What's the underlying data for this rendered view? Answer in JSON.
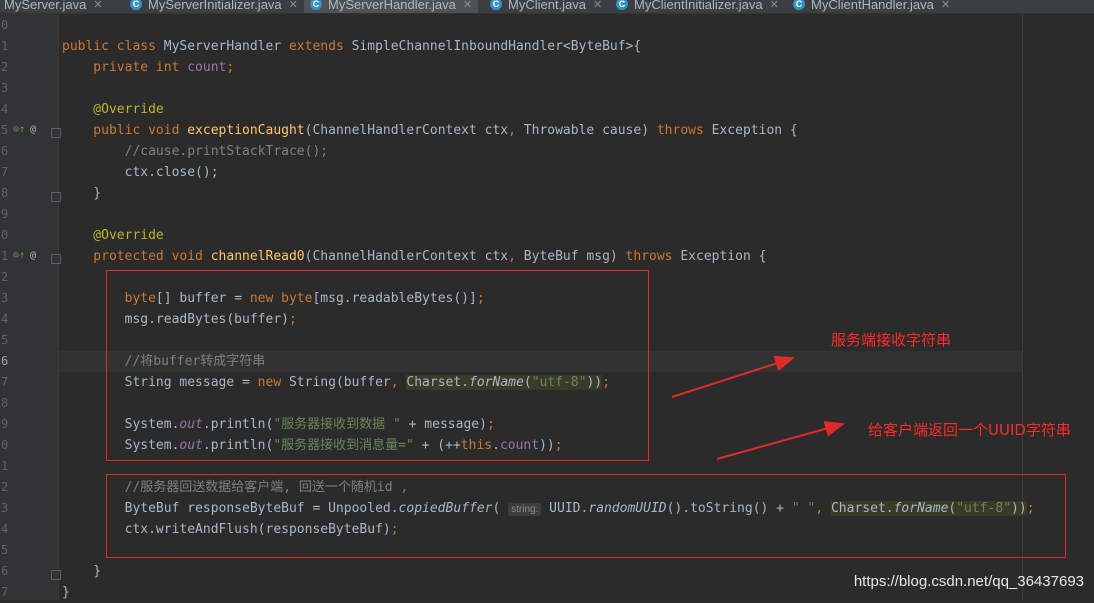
{
  "tabs": [
    {
      "label": "MyServer.java",
      "active": false
    },
    {
      "label": "MyServerInitializer.java",
      "active": false
    },
    {
      "label": "MyServerHandler.java",
      "active": true
    },
    {
      "label": "MyClient.java",
      "active": false
    },
    {
      "label": "MyClientInitializer.java",
      "active": false
    },
    {
      "label": "MyClientHandler.java",
      "active": false
    }
  ],
  "gutter": {
    "line_numbers": [
      "0",
      "1",
      "2",
      "3",
      "4",
      "5",
      "6",
      "7",
      "8",
      "9",
      "0",
      "1",
      "2",
      "3",
      "4",
      "5",
      "6",
      "7",
      "8",
      "9",
      "0",
      "1",
      "2",
      "3",
      "4",
      "5",
      "6",
      "7",
      "8"
    ]
  },
  "code": {
    "l1_a": "public class ",
    "l1_b": "MyServerHandler ",
    "l1_c": "extends ",
    "l1_d": "SimpleChannelInboundHandler<ByteBuf>{",
    "l2_a": "    private int ",
    "l2_b": "count",
    "l2_c": ";",
    "l4": "    @Override",
    "l5_a": "    public void ",
    "l5_b": "exceptionCaught",
    "l5_c": "(ChannelHandlerContext ctx",
    "l5_d": ", ",
    "l5_e": "Throwable cause) ",
    "l5_f": "throws ",
    "l5_g": "Exception {",
    "l6": "        //cause.printStackTrace();",
    "l7": "        ctx.close();",
    "l8": "    }",
    "l10": "    @Override",
    "l11_a": "    protected void ",
    "l11_b": "channelRead0",
    "l11_c": "(ChannelHandlerContext ctx",
    "l11_d": ", ",
    "l11_e": "ByteBuf msg) ",
    "l11_f": "throws ",
    "l11_g": "Exception {",
    "l13_a": "        byte",
    "l13_b": "[] buffer = ",
    "l13_c": "new byte",
    "l13_d": "[msg.readableBytes()]",
    "l13_e": ";",
    "l14_a": "        msg.readBytes(buffer)",
    "l14_b": ";",
    "l16": "        //将buffer转成字符串",
    "l17_a": "        String message = ",
    "l17_b": "new ",
    "l17_c": "String(buffer",
    "l17_d": ", ",
    "l17_e": "Charset.",
    "l17_f": "forName",
    "l17_g": "(",
    "l17_h": "\"utf-8\"",
    "l17_i": "))",
    "l17_j": ";",
    "l19_a": "        System.",
    "l19_b": "out",
    "l19_c": ".println(",
    "l19_d": "\"服务器接收到数据 \" ",
    "l19_e": "+ message)",
    "l19_f": ";",
    "l20_a": "        System.",
    "l20_b": "out",
    "l20_c": ".println(",
    "l20_d": "\"服务器接收到消息量=\" ",
    "l20_e": "+ (++",
    "l20_f": "this",
    "l20_g": ".",
    "l20_h": "count",
    "l20_i": "))",
    "l20_j": ";",
    "l22": "        //服务器回送数据给客户端, 回送一个随机id ,",
    "l23_a": "        ByteBuf responseByteBuf = Unpooled.",
    "l23_b": "copiedBuffer",
    "l23_c": "( ",
    "l23_hint": "string:",
    "l23_d": " UUID.",
    "l23_e": "randomUUID",
    "l23_f": "().toString() + ",
    "l23_g": "\" \"",
    "l23_h": ", ",
    "l23_i": "Charset.",
    "l23_j": "forName",
    "l23_k": "(",
    "l23_l": "\"utf-8\"",
    "l23_m": "))",
    "l23_n": ";",
    "l24_a": "        ctx.writeAndFlush(responseByteBuf)",
    "l24_b": ";",
    "l26": "    }",
    "l27": "}"
  },
  "annotations": {
    "note1": "服务端接收字符串",
    "note2": "给客户端返回一个UUID字符串"
  },
  "watermark": "https://blog.csdn.net/qq_36437693",
  "colors": {
    "accent": "#e02b2b",
    "background": "#2b2b2b",
    "keyword": "#cc7832"
  }
}
